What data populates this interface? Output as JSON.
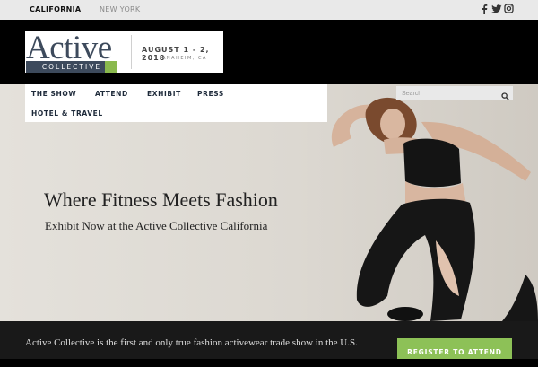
{
  "topbar": {
    "locations": [
      "CALIFORNIA",
      "NEW YORK"
    ],
    "social": [
      "facebook-icon",
      "twitter-icon",
      "instagram-icon"
    ]
  },
  "logo": {
    "wordmark": "Active",
    "sub": "COLLECTIVE",
    "dates": "AUGUST 1 - 2, 2018",
    "place": "ANAHEIM, CA"
  },
  "nav": {
    "items": [
      "THE SHOW",
      "ATTEND",
      "EXHIBIT",
      "PRESS",
      "HOTEL & TRAVEL"
    ]
  },
  "search": {
    "placeholder": "Search"
  },
  "hero": {
    "headline": "Where Fitness Meets Fashion",
    "subhead": "Exhibit Now at the Active Collective California"
  },
  "footer": {
    "text": "Active Collective is the first and only true fashion activewear trade show in the U.S.",
    "cta": "REGISTER TO ATTEND"
  },
  "colors": {
    "accent": "#8dc157",
    "brand": "#3d4a5c",
    "dark": "#191919"
  }
}
